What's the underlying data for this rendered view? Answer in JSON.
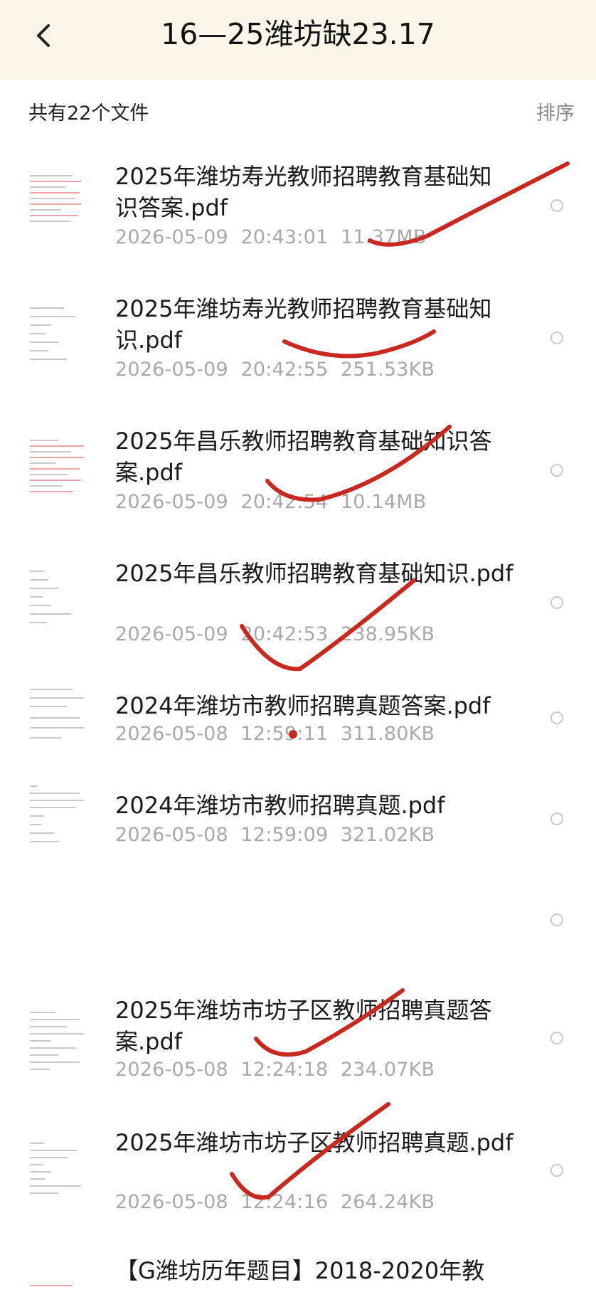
{
  "header": {
    "title": "16—25潍坊缺23.17"
  },
  "summary": {
    "count_text": "共有22个文件",
    "sort_label": "排序"
  },
  "files": [
    {
      "name": "2025年潍坊寿光教师招聘教育基础知识答案.pdf",
      "meta": "2026-05-09  20:43:01  11.37MB"
    },
    {
      "name": "2025年潍坊寿光教师招聘教育基础知识.pdf",
      "meta": "2026-05-09  20:42:55  251.53KB"
    },
    {
      "name": "2025年昌乐教师招聘教育基础知识答案.pdf",
      "meta": "2026-05-09  20:42:54  10.14MB"
    },
    {
      "name": "2025年昌乐教师招聘教育基础知识.pdf",
      "meta": "2026-05-09  20:42:53  238.95KB"
    },
    {
      "name": "2024年潍坊市教师招聘真题答案.pdf",
      "meta": "2026-05-08  12:59:11  311.80KB"
    },
    {
      "name": "2024年潍坊市教师招聘真题.pdf",
      "meta": "2026-05-08  12:59:09  321.02KB"
    },
    {
      "name": "",
      "meta": ""
    },
    {
      "name": "2025年潍坊市坊子区教师招聘真题答案.pdf",
      "meta": "2026-05-08  12:24:18  234.07KB"
    },
    {
      "name": "2025年潍坊市坊子区教师招聘真题.pdf",
      "meta": "2026-05-08  12:24:16  264.24KB"
    },
    {
      "name": "【G潍坊历年题目】2018-2020年教",
      "meta": ""
    }
  ],
  "icons": {
    "back": "chevron-left-icon",
    "select": "radio-circle-icon"
  },
  "colors": {
    "header_bg": "#fbf6e9",
    "meta_text": "#a9a9a9",
    "annotation": "#c8281e"
  }
}
